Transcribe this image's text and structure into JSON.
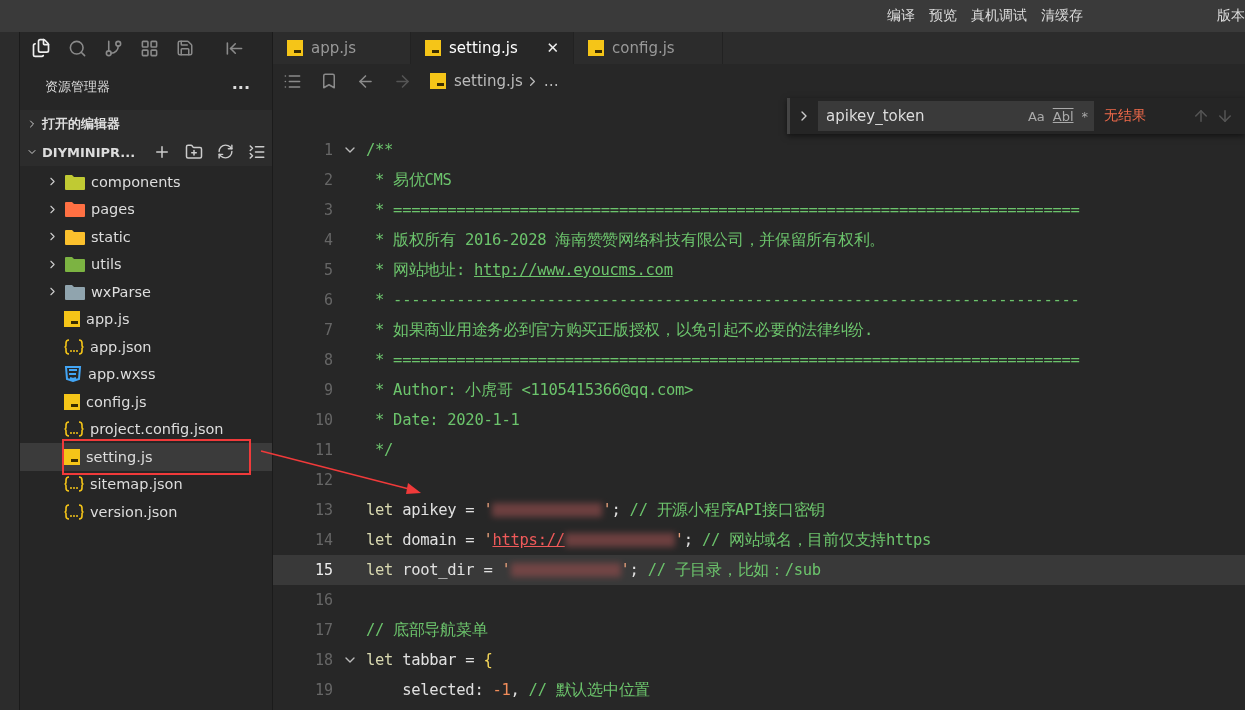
{
  "menu_bar": {
    "items": [
      "编译",
      "预览",
      "真机调试",
      "清缓存",
      "版本"
    ]
  },
  "sidebar": {
    "title": "资源管理器",
    "more": "···",
    "sections": [
      {
        "label": "打开的编辑器",
        "expanded": false
      },
      {
        "label": "DIYMINIPR...",
        "expanded": true
      }
    ],
    "tree": [
      {
        "name": "components",
        "kind": "folder",
        "color": "#c0ca33",
        "expanded": false,
        "selected": false,
        "boxed": false
      },
      {
        "name": "pages",
        "kind": "folder",
        "color": "#ff7043",
        "expanded": false,
        "selected": false,
        "boxed": false
      },
      {
        "name": "static",
        "kind": "folder",
        "color": "#fbc02d",
        "expanded": false,
        "selected": false,
        "boxed": false
      },
      {
        "name": "utils",
        "kind": "folder",
        "color": "#7cb342",
        "expanded": false,
        "selected": false,
        "boxed": false
      },
      {
        "name": "wxParse",
        "kind": "folder",
        "color": "#90a4ae",
        "expanded": false,
        "selected": false,
        "boxed": false
      },
      {
        "name": "app.js",
        "kind": "js",
        "selected": false,
        "boxed": false
      },
      {
        "name": "app.json",
        "kind": "json",
        "selected": false,
        "boxed": false
      },
      {
        "name": "app.wxss",
        "kind": "css",
        "selected": false,
        "boxed": false
      },
      {
        "name": "config.js",
        "kind": "js",
        "selected": false,
        "boxed": false
      },
      {
        "name": "project.config.json",
        "kind": "json",
        "selected": false,
        "boxed": false
      },
      {
        "name": "setting.js",
        "kind": "js",
        "selected": true,
        "boxed": true
      },
      {
        "name": "sitemap.json",
        "kind": "json",
        "selected": false,
        "boxed": false
      },
      {
        "name": "version.json",
        "kind": "json",
        "selected": false,
        "boxed": false
      }
    ]
  },
  "tabs": [
    {
      "label": "app.js",
      "selected": false
    },
    {
      "label": "setting.js",
      "selected": true,
      "close": "✕"
    },
    {
      "label": "config.js",
      "selected": false
    }
  ],
  "breadcrumb": {
    "file": "setting.js",
    "more": "…"
  },
  "find": {
    "value": "apikey_token",
    "options": [
      {
        "label": "Aa",
        "kind": "case"
      },
      {
        "label": "Abl",
        "kind": "word"
      },
      {
        "label": "*",
        "kind": "regex"
      }
    ],
    "result": "无结果"
  },
  "editor": {
    "lines": [
      {
        "number": "1",
        "expanded": true,
        "tokens": [
          {
            "kind": "comment",
            "text": "/**"
          }
        ]
      },
      {
        "number": "2",
        "tokens": [
          {
            "kind": "comment",
            "text": " * 易优CMS"
          }
        ]
      },
      {
        "number": "3",
        "tokens": [
          {
            "kind": "comment",
            "text": " * ============================================================================"
          }
        ]
      },
      {
        "number": "4",
        "tokens": [
          {
            "kind": "comment",
            "text": " * 版权所有 2016-2028 海南赞赞网络科技有限公司，并保留所有权利。"
          }
        ]
      },
      {
        "number": "5",
        "tokens": [
          {
            "kind": "comment",
            "text": " * 网站地址: "
          },
          {
            "kind": "link",
            "text": "http://www.eyoucms.com"
          }
        ]
      },
      {
        "number": "6",
        "tokens": [
          {
            "kind": "comment",
            "text": " * ----------------------------------------------------------------------------"
          }
        ]
      },
      {
        "number": "7",
        "tokens": [
          {
            "kind": "comment",
            "text": " * 如果商业用途务必到官方购买正版授权，以免引起不必要的法律纠纷."
          }
        ]
      },
      {
        "number": "8",
        "tokens": [
          {
            "kind": "comment",
            "text": " * ============================================================================"
          }
        ]
      },
      {
        "number": "9",
        "tokens": [
          {
            "kind": "comment",
            "text": " * Author: 小虎哥 <1105415366@qq.com>"
          }
        ]
      },
      {
        "number": "10",
        "tokens": [
          {
            "kind": "comment",
            "text": " * Date: 2020-1-1"
          }
        ]
      },
      {
        "number": "11",
        "tokens": [
          {
            "kind": "comment",
            "text": " */"
          }
        ]
      },
      {
        "number": "12"
      },
      {
        "number": "13",
        "tokens": [
          {
            "kind": "keyword",
            "text": "let"
          },
          {
            "kind": "plain",
            "text": " apikey = "
          },
          {
            "kind": "string",
            "text": "'"
          },
          {
            "kind": "redacted"
          },
          {
            "kind": "string",
            "text": "'"
          },
          {
            "kind": "plain",
            "text": "; "
          },
          {
            "kind": "comment",
            "text": "// 开源小程序API接口密钥"
          }
        ]
      },
      {
        "number": "14",
        "tokens": [
          {
            "kind": "keyword",
            "text": "let"
          },
          {
            "kind": "plain",
            "text": " domain = "
          },
          {
            "kind": "string",
            "text": "'"
          },
          {
            "kind": "url",
            "text": "https://"
          },
          {
            "kind": "redacted"
          },
          {
            "kind": "string",
            "text": "'"
          },
          {
            "kind": "plain",
            "text": "; "
          },
          {
            "kind": "comment",
            "text": "// 网站域名，目前仅支持https"
          }
        ]
      },
      {
        "number": "15",
        "current": true,
        "tokens": [
          {
            "kind": "keyword",
            "text": "let"
          },
          {
            "kind": "plain",
            "text": " root_dir = "
          },
          {
            "kind": "string",
            "text": "'"
          },
          {
            "kind": "redacted"
          },
          {
            "kind": "string",
            "text": "'"
          },
          {
            "kind": "plain",
            "text": "; "
          },
          {
            "kind": "comment",
            "text": "// 子目录，比如：/sub"
          }
        ]
      },
      {
        "number": "16"
      },
      {
        "number": "17",
        "tokens": [
          {
            "kind": "comment",
            "text": "// 底部导航菜单"
          }
        ]
      },
      {
        "number": "18",
        "expanded": true,
        "tokens": [
          {
            "kind": "keyword",
            "text": "let"
          },
          {
            "kind": "plain",
            "text": " tabbar = "
          },
          {
            "kind": "brace",
            "text": "{"
          }
        ]
      },
      {
        "number": "19",
        "tokens": [
          {
            "kind": "plain",
            "text": "    selected: "
          },
          {
            "kind": "number",
            "text": "-1"
          },
          {
            "kind": "plain",
            "text": ", "
          },
          {
            "kind": "comment",
            "text": "// 默认选中位置"
          }
        ]
      }
    ]
  }
}
